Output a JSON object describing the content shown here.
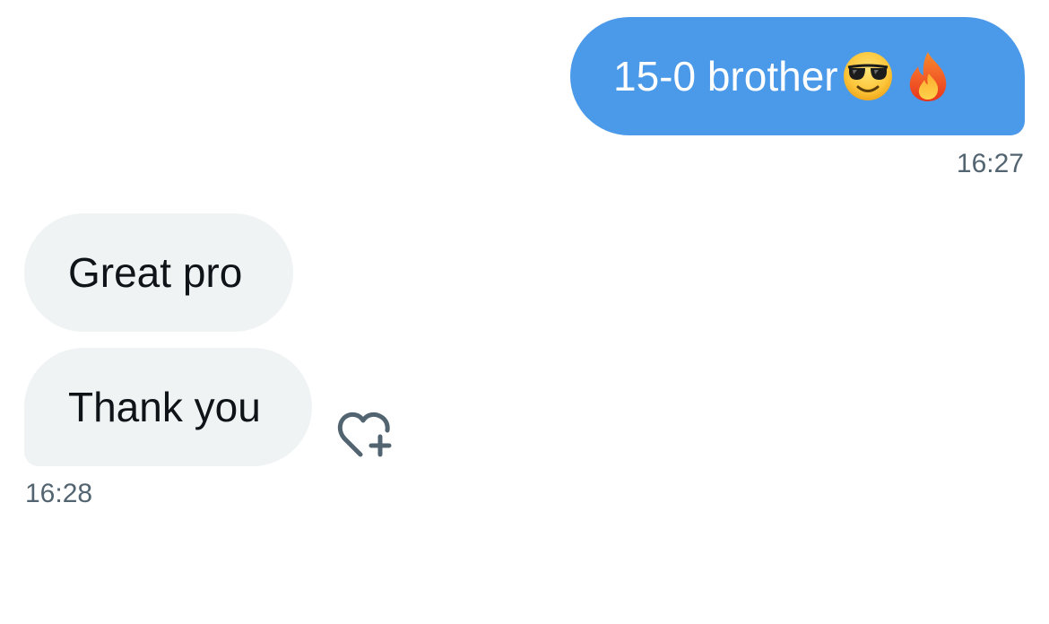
{
  "conversation": {
    "sent": {
      "text": "15-0 brother",
      "emojis": [
        "smiling-face-with-sunglasses",
        "fire"
      ],
      "time": "16:27",
      "bubble_color": "#4b99e9"
    },
    "received": [
      {
        "text": "Great pro"
      },
      {
        "text": "Thank you"
      }
    ],
    "received_time": "16:28",
    "received_bubble_color": "#eff3f4",
    "react_icon": "heart-plus-icon"
  }
}
